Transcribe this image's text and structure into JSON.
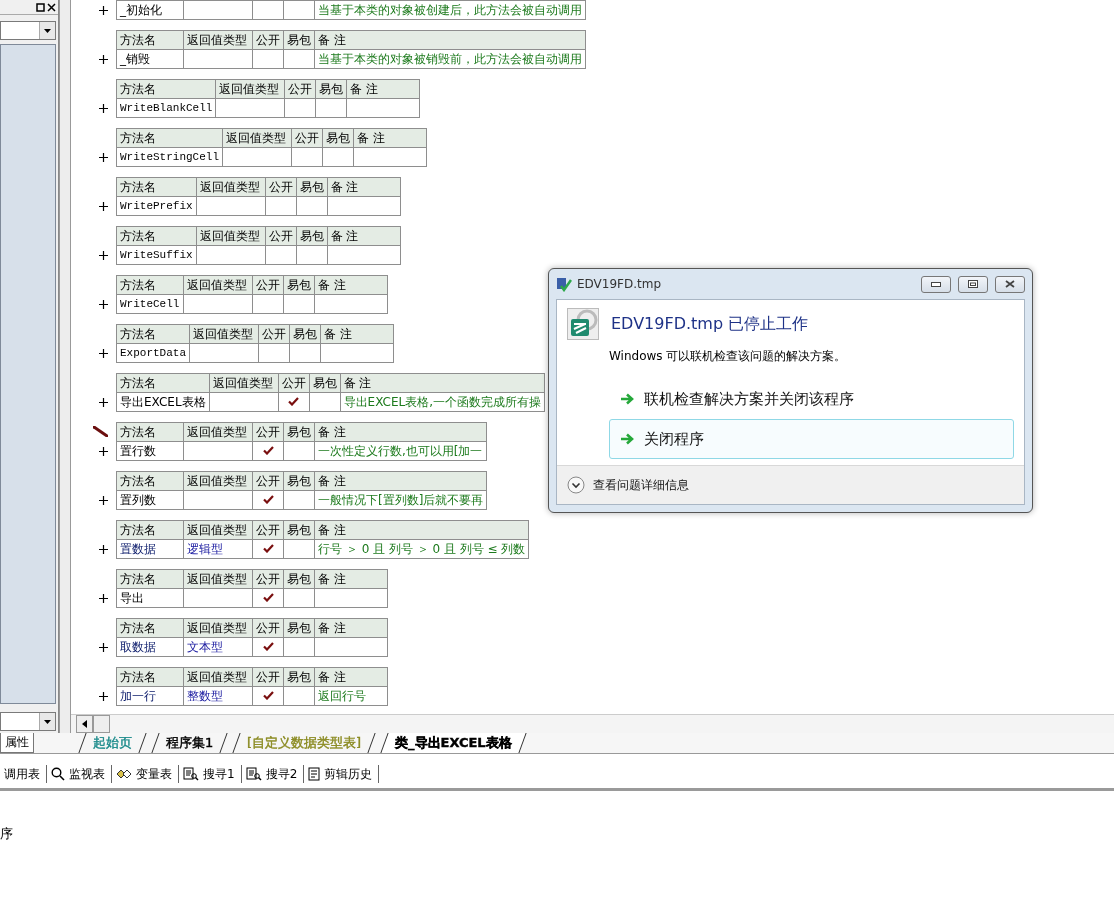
{
  "left_panel": {
    "tab": {
      "label": "属性",
      "selected": true
    }
  },
  "methods": [
    {
      "kind": "row_only",
      "name": "_初始化",
      "public": false,
      "editing": false,
      "remark": "当基于本类的对象被创建后，此方法会被自动调用"
    },
    {
      "kind": "full",
      "header": [
        "方法名",
        "返回值类型",
        "公开",
        "易包",
        "备 注"
      ],
      "name": "_销毁",
      "public": false,
      "editing": false,
      "remark": "当基于本类的对象被销毁前，此方法会被自动调用"
    },
    {
      "kind": "full",
      "header": [
        "方法名",
        "返回值类型",
        "公开",
        "易包",
        "备 注"
      ],
      "name": "WriteBlankCell",
      "latin": true,
      "public": false,
      "editing": false
    },
    {
      "kind": "full",
      "header": [
        "方法名",
        "返回值类型",
        "公开",
        "易包",
        "备 注"
      ],
      "name": "WriteStringCell",
      "latin": true,
      "public": false,
      "editing": false
    },
    {
      "kind": "full",
      "header": [
        "方法名",
        "返回值类型",
        "公开",
        "易包",
        "备 注"
      ],
      "name": "WritePrefix",
      "latin": true,
      "public": false,
      "editing": false
    },
    {
      "kind": "full",
      "header": [
        "方法名",
        "返回值类型",
        "公开",
        "易包",
        "备 注"
      ],
      "name": "WriteSuffix",
      "latin": true,
      "public": false,
      "editing": false
    },
    {
      "kind": "full",
      "header": [
        "方法名",
        "返回值类型",
        "公开",
        "易包",
        "备 注"
      ],
      "name": "WriteCell",
      "latin": true,
      "public": false,
      "editing": false
    },
    {
      "kind": "full",
      "header": [
        "方法名",
        "返回值类型",
        "公开",
        "易包",
        "备 注"
      ],
      "name": "ExportData",
      "latin": true,
      "public": false,
      "editing": false
    },
    {
      "kind": "full",
      "header": [
        "方法名",
        "返回值类型",
        "公开",
        "易包",
        "备 注"
      ],
      "name": "导出EXCEL表格",
      "public": true,
      "editing": false,
      "remark": "导出EXCEL表格,一个函数完成所有操"
    },
    {
      "kind": "full",
      "header": [
        "方法名",
        "返回值类型",
        "公开",
        "易包",
        "备 注"
      ],
      "name": "置行数",
      "public": true,
      "editing": true,
      "remark": "一次性定义行数,也可以用[加一"
    },
    {
      "kind": "full",
      "header": [
        "方法名",
        "返回值类型",
        "公开",
        "易包",
        "备 注"
      ],
      "name": "置列数",
      "public": true,
      "editing": false,
      "remark": "一般情况下[置列数]后就不要再"
    },
    {
      "kind": "full",
      "header": [
        "方法名",
        "返回值类型",
        "公开",
        "易包",
        "备 注"
      ],
      "name": "置数据",
      "return_type": "逻辑型",
      "public": true,
      "editing": false,
      "remark": "行号 ＞ 0 且 列号 ＞ 0 且 列号 ≤ 列数"
    },
    {
      "kind": "full",
      "header": [
        "方法名",
        "返回值类型",
        "公开",
        "易包",
        "备 注"
      ],
      "name": "导出",
      "public": true,
      "editing": false
    },
    {
      "kind": "full",
      "header": [
        "方法名",
        "返回值类型",
        "公开",
        "易包",
        "备 注"
      ],
      "name": "取数据",
      "return_type": "文本型",
      "public": true,
      "editing": false
    },
    {
      "kind": "full",
      "header": [
        "方法名",
        "返回值类型",
        "公开",
        "易包",
        "备 注"
      ],
      "name": "加一行",
      "return_type": "整数型",
      "public": true,
      "editing": false,
      "remark": "返回行号"
    }
  ],
  "editor_tabs": [
    {
      "label": "起始页",
      "selected": false,
      "color": "#1a8a8a"
    },
    {
      "label": "程序集1",
      "selected": false,
      "color": "#000000"
    },
    {
      "label": "[自定义数据类型表]",
      "selected": false,
      "color": "#8a8a20"
    },
    {
      "label": "类_导出EXCEL表格",
      "selected": true,
      "color": "#000000"
    }
  ],
  "toolbar": [
    {
      "label": "调用表"
    },
    {
      "label": "监视表"
    },
    {
      "label": "变量表"
    },
    {
      "label": "搜寻1"
    },
    {
      "label": "搜寻2"
    },
    {
      "label": "剪辑历史"
    }
  ],
  "output": {
    "text": "序"
  },
  "dialog": {
    "title": "EDV19FD.tmp",
    "heading": "EDV19FD.tmp 已停止工作",
    "message": "Windows 可以联机检查该问题的解决方案。",
    "options": [
      {
        "label": "联机检查解决方案并关闭该程序",
        "selected": false
      },
      {
        "label": "关闭程序",
        "selected": true
      }
    ],
    "details": "查看问题详细信息"
  }
}
